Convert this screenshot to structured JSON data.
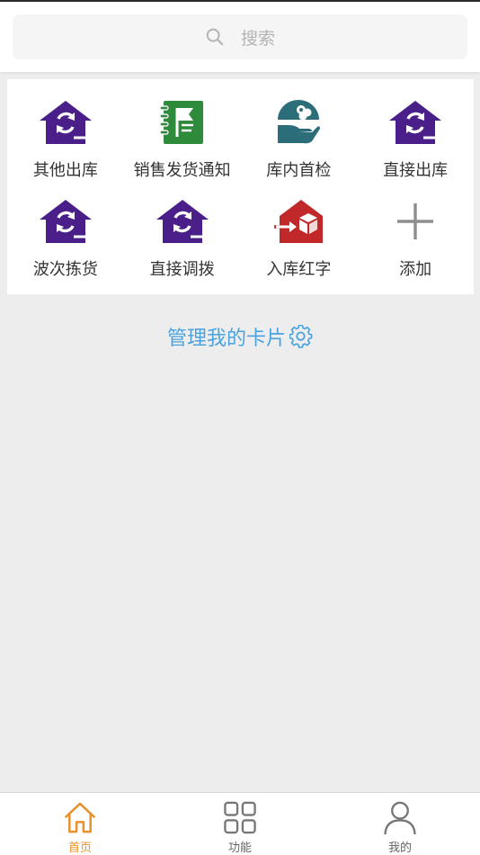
{
  "search": {
    "placeholder": "搜索"
  },
  "cards": [
    {
      "label": "其他出库",
      "icon": "house-transfer-icon"
    },
    {
      "label": "销售发货通知",
      "icon": "notebook-flag-icon"
    },
    {
      "label": "库内首检",
      "icon": "hand-coins-icon"
    },
    {
      "label": "直接出库",
      "icon": "house-transfer-icon"
    },
    {
      "label": "波次拣货",
      "icon": "house-transfer-icon"
    },
    {
      "label": "直接调拨",
      "icon": "house-transfer-icon"
    },
    {
      "label": "入库红字",
      "icon": "house-box-in-icon"
    },
    {
      "label": "添加",
      "icon": "plus-icon"
    }
  ],
  "manage": {
    "label": "管理我的卡片"
  },
  "tabbar": {
    "items": [
      {
        "label": "首页",
        "icon": "home-icon",
        "active": true
      },
      {
        "label": "功能",
        "icon": "grid-icon",
        "active": false
      },
      {
        "label": "我的",
        "icon": "user-icon",
        "active": false
      }
    ]
  },
  "colors": {
    "purple": "#4a1f8a",
    "green": "#2e8b3c",
    "teal": "#2b6e7a",
    "red": "#c0282a",
    "accent_blue": "#4aa3df",
    "active_tab": "#e8922e"
  }
}
